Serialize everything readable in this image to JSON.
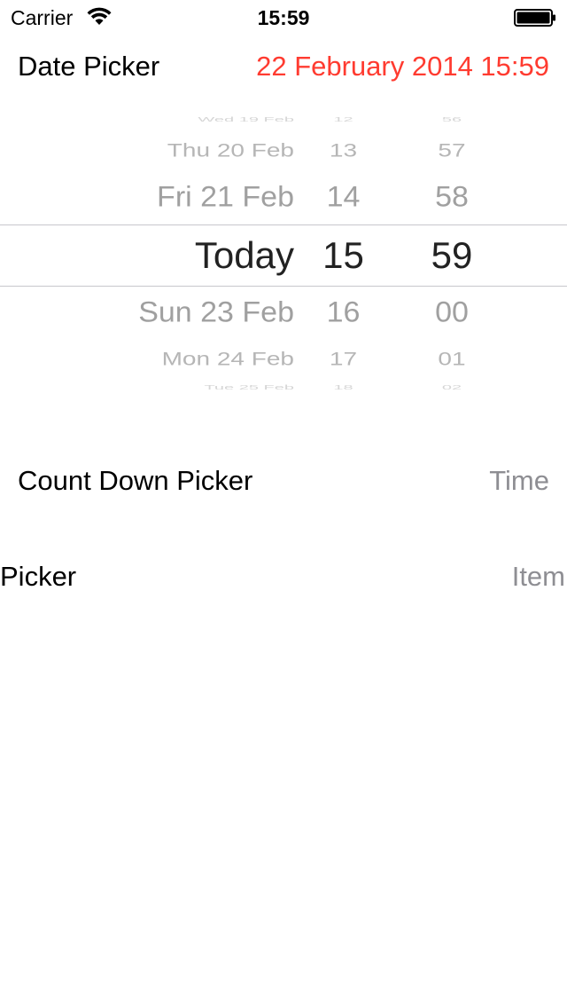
{
  "status_bar": {
    "carrier": "Carrier",
    "time": "15:59",
    "wifi_icon": "wifi-icon",
    "battery_icon": "battery-full-icon"
  },
  "date_picker_row": {
    "label": "Date Picker",
    "value": "22 February 2014 15:59",
    "value_color": "#ff3b30"
  },
  "date_wheel": {
    "rows": [
      {
        "date": "Wed 19 Feb",
        "hour": "12",
        "minute": "56"
      },
      {
        "date": "Thu 20 Feb",
        "hour": "13",
        "minute": "57"
      },
      {
        "date": "Fri 21 Feb",
        "hour": "14",
        "minute": "58"
      },
      {
        "date": "Today",
        "hour": "15",
        "minute": "59"
      },
      {
        "date": "Sun 23 Feb",
        "hour": "16",
        "minute": "00"
      },
      {
        "date": "Mon 24 Feb",
        "hour": "17",
        "minute": "01"
      },
      {
        "date": "Tue 25 Feb",
        "hour": "18",
        "minute": "02"
      }
    ]
  },
  "count_down_row": {
    "label": "Count Down Picker",
    "value": "Time"
  },
  "picker_row": {
    "label": "Picker",
    "value": "Item"
  },
  "colors": {
    "accent": "#ff3b30",
    "secondary_text": "#8e8e93",
    "separator": "#c8c7cc"
  }
}
